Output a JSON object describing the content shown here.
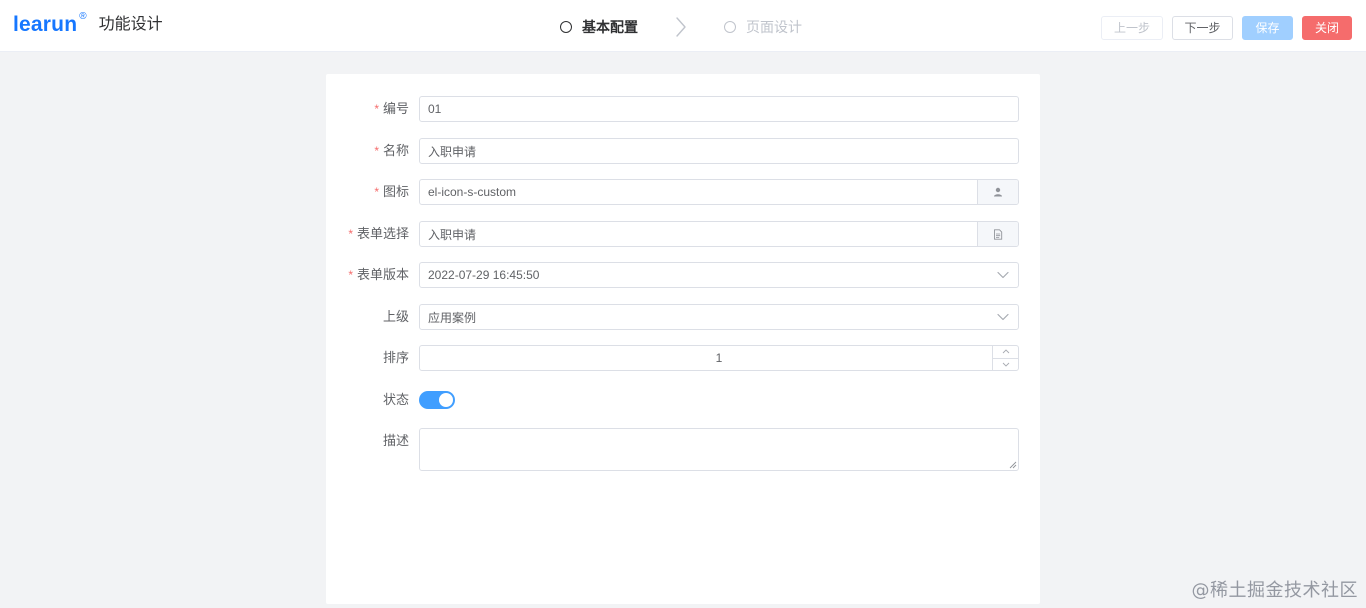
{
  "brand": {
    "logo_text": "learun",
    "registered_mark": "®",
    "title": "功能设计",
    "logo_color": "#1677ff"
  },
  "steps": [
    {
      "label": "基本配置",
      "state": "active"
    },
    {
      "label": "页面设计",
      "state": "inactive"
    }
  ],
  "actions": {
    "prev": "上一步",
    "next": "下一步",
    "save": "保存",
    "close": "关闭"
  },
  "form": {
    "fields": [
      {
        "label": "编号",
        "required": true,
        "value": "01"
      },
      {
        "label": "名称",
        "required": true,
        "value": "入职申请"
      },
      {
        "label": "图标",
        "required": true,
        "value": "el-icon-s-custom",
        "append_icon": "user-icon"
      },
      {
        "label": "表单选择",
        "required": true,
        "value": "入职申请",
        "append_icon": "document-icon"
      },
      {
        "label": "表单版本",
        "required": true,
        "value": "2022-07-29 16:45:50",
        "suffix_icon": "chevron-down-icon"
      },
      {
        "label": "上级",
        "required": false,
        "value": "应用案例",
        "suffix_icon": "chevron-down-icon"
      },
      {
        "label": "排序",
        "required": false,
        "value": "1"
      },
      {
        "label": "状态",
        "required": false,
        "value": true
      },
      {
        "label": "描述",
        "required": false,
        "value": ""
      }
    ],
    "required_mark": "*"
  },
  "colors": {
    "primary": "#409eff",
    "danger": "#f56c6c",
    "primary_disabled": "#a0cfff",
    "background": "#f2f3f5"
  },
  "watermark": "@稀土掘金技术社区"
}
